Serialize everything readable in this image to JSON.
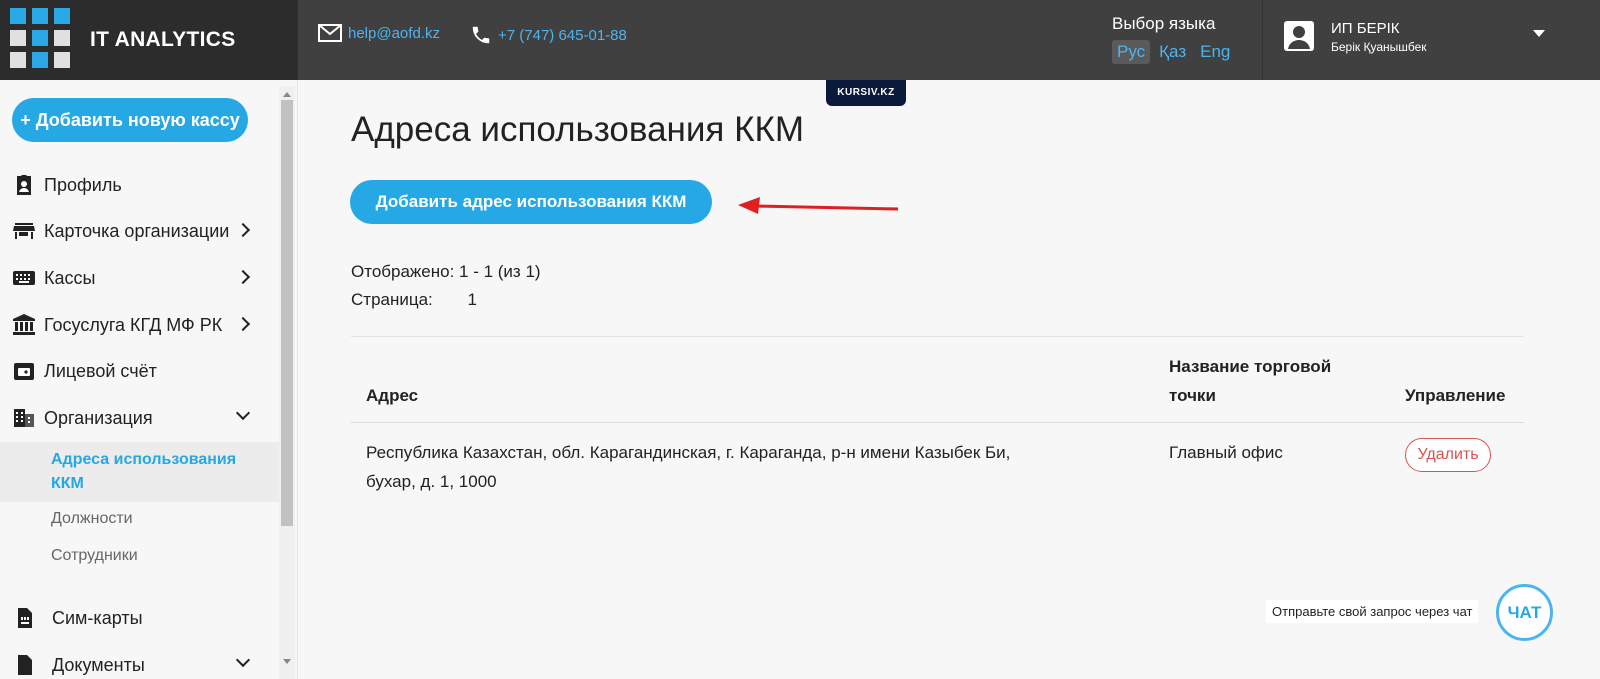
{
  "brand": {
    "name": "IT ANALYTICS"
  },
  "header": {
    "email": "help@aofd.kz",
    "phone": "+7 (747) 645-01-88",
    "language": {
      "title": "Выбор языка",
      "options": [
        {
          "label": "Рус",
          "active": true
        },
        {
          "label": "Қаз",
          "active": false
        },
        {
          "label": "Eng",
          "active": false
        }
      ]
    },
    "user": {
      "name": "ИП БЕРІК",
      "full_name": "Берік Қуанышбек"
    }
  },
  "badge": {
    "text": "KURSIV.KZ"
  },
  "sidebar": {
    "add_button": "+ Добавить новую кассу",
    "items": [
      {
        "label": "Профиль",
        "icon": "profile-badge-icon"
      },
      {
        "label": "Карточка организации",
        "icon": "store-icon"
      },
      {
        "label": "Кассы",
        "icon": "keyboard-icon"
      },
      {
        "label": "Госуслуга КГД МФ РК",
        "icon": "bank-icon"
      },
      {
        "label": "Лицевой счёт",
        "icon": "wallet-icon"
      },
      {
        "label": "Организация",
        "icon": "building-icon"
      }
    ],
    "sub_items": [
      {
        "label": "Адреса использования ККМ",
        "active": true
      },
      {
        "label": "Должности",
        "active": false
      },
      {
        "label": "Сотрудники",
        "active": false
      }
    ],
    "items_bottom": [
      {
        "label": "Сим-карты",
        "icon": "sim-card-icon"
      },
      {
        "label": "Документы",
        "icon": "document-icon"
      }
    ]
  },
  "main": {
    "title": "Адреса использования ККМ",
    "add_button": "Добавить адрес использования ККМ",
    "shown": "Отображено: 1 - 1 (из 1)",
    "page_label": "Страница:",
    "page_number": "1",
    "table": {
      "headers": {
        "address": "Адрес",
        "shop_line1": "Название торговой",
        "shop_line2": "точки",
        "actions": "Управление"
      },
      "rows": [
        {
          "address_line1": "Республика Казахстан, обл. Карагандинская, г. Караганда, р-н имени Казыбек Би,",
          "address_line2": "бухар, д. 1, 1000",
          "shop": "Главный офис",
          "action": "Удалить"
        }
      ]
    }
  },
  "chat": {
    "prompt": "Отправьте свой запрос через чат",
    "button": "ЧАТ"
  },
  "colors": {
    "accent": "#26a8e4",
    "header_bg": "#404040",
    "danger": "#d9534f",
    "arrow": "#e02020"
  }
}
